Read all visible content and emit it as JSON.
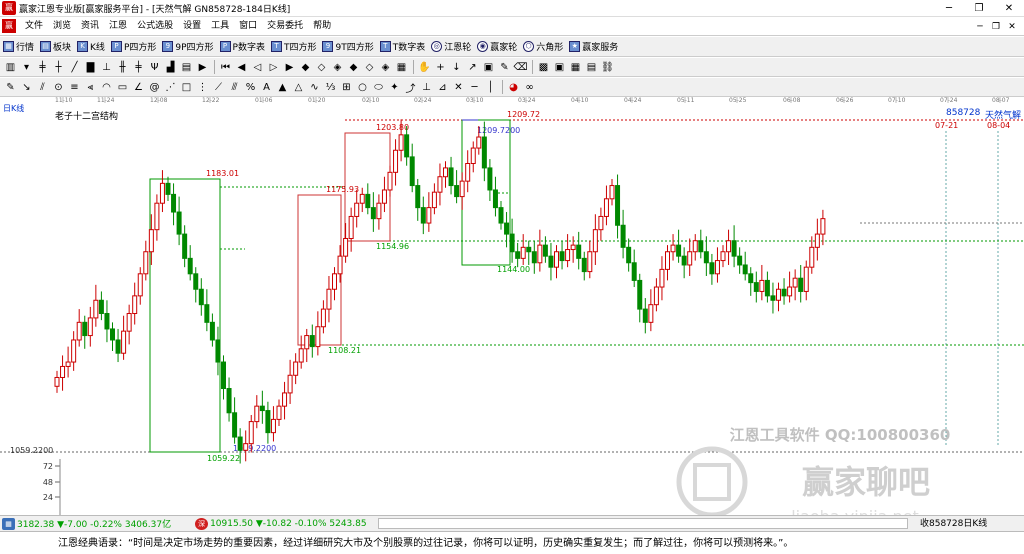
{
  "window": {
    "title": "赢家江恩专业版[赢家服务平台] - [天然气解  GN858728-184日K线]",
    "controls": {
      "minimize": "─",
      "restore": "❐",
      "close": "✕"
    }
  },
  "menu": {
    "items": [
      "文件",
      "浏览",
      "资讯",
      "江恩",
      "公式选股",
      "设置",
      "工具",
      "窗口",
      "交易委托",
      "帮助"
    ],
    "right": [
      "─",
      "❐",
      "✕"
    ]
  },
  "toolbar1": {
    "buttons": [
      {
        "label": "行情",
        "icon": "grid-icon"
      },
      {
        "label": "板块",
        "icon": "blocks-icon"
      },
      {
        "label": "K线",
        "icon": "kline-icon"
      },
      {
        "label": "P四方形",
        "icon": "p-square-icon"
      },
      {
        "label": "9P四方形",
        "icon": "9p-square-icon"
      },
      {
        "label": "P数字表",
        "icon": "p-table-icon"
      },
      {
        "label": "T四方形",
        "icon": "t-square-icon"
      },
      {
        "label": "9T四方形",
        "icon": "9t-square-icon"
      },
      {
        "label": "T数字表",
        "icon": "t-table-icon"
      },
      {
        "label": "江恩轮",
        "icon": "gann-wheel-icon"
      },
      {
        "label": "赢家轮",
        "icon": "winner-wheel-icon"
      },
      {
        "label": "六角形",
        "icon": "hexagon-icon"
      },
      {
        "label": "赢家服务",
        "icon": "service-icon"
      }
    ]
  },
  "chart": {
    "period_label": "日K线",
    "study_label": "老子十二宫结构",
    "code": "858728",
    "name": "天然气解",
    "date_ticks": [
      "11-10",
      "11-24",
      "12-08",
      "12-22",
      "01-06",
      "01-20",
      "02-10",
      "02-24",
      "03-10",
      "03-24",
      "04-10",
      "04-24",
      "05-11",
      "05-25",
      "06-08",
      "06-26",
      "07-10",
      "07-24",
      "08-07"
    ],
    "date_markers": [
      "07-21",
      "08-04"
    ],
    "price_labels": [
      {
        "text": "1203.80",
        "color": "#cc0000"
      },
      {
        "text": "1209.72",
        "color": "#cc0000"
      },
      {
        "text": "1209.7200",
        "color": "#3333cc"
      },
      {
        "text": "1183.01",
        "color": "#cc0000"
      },
      {
        "text": "1175.93",
        "color": "#cc0000"
      },
      {
        "text": "1154.96",
        "color": "#00a000"
      },
      {
        "text": "1144.00",
        "color": "#00a000"
      },
      {
        "text": "1108.21",
        "color": "#00a000"
      },
      {
        "text": "1059.2200",
        "color": "#3333cc"
      },
      {
        "text": "1059.22",
        "color": "#00a000"
      }
    ],
    "yaxis_label": "1059.2200",
    "volume_ticks": [
      "72",
      "48",
      "24"
    ],
    "watermark": {
      "line1": "江恩工具软件  QQ:100800360",
      "line2": "赢家聊吧",
      "line3": "liaoba.yinjia.net"
    }
  },
  "statusbar": {
    "idx1": "3182.38 ▼-7.00 -0.22% 3406.37亿",
    "idx2": "10915.50 ▼-10.82 -0.10% 5243.85",
    "right": "收858728日K线"
  },
  "quote": "江恩经典语录：“时间是决定市场走势的重要因素，经过详细研究大市及个别股票的过往记录，你将可以证明，历史确实重复发生；而了解过往，你将可以预测将来。”。"
}
